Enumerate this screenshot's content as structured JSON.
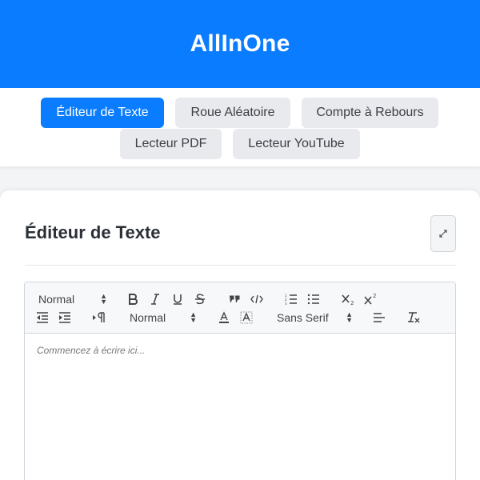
{
  "app": {
    "title": "AllInOne"
  },
  "tabs": [
    {
      "label": "Éditeur de Texte"
    },
    {
      "label": "Roue Aléatoire"
    },
    {
      "label": "Compte à Rebours"
    },
    {
      "label": "Lecteur PDF"
    },
    {
      "label": "Lecteur YouTube"
    }
  ],
  "active_tab": 0,
  "card": {
    "title": "Éditeur de Texte",
    "expand_icon": "expand-icon"
  },
  "editor": {
    "header_picker": "Normal",
    "size_picker": "Normal",
    "font_picker": "Sans Serif",
    "placeholder": "Commencez à écrire ici...",
    "toolbar_icons": [
      "bold-icon",
      "italic-icon",
      "underline-icon",
      "strike-icon",
      "blockquote-icon",
      "code-block-icon",
      "ordered-list-icon",
      "bullet-list-icon",
      "subscript-icon",
      "superscript-icon",
      "outdent-icon",
      "indent-icon",
      "rtl-direction-icon",
      "text-color-icon",
      "background-color-icon",
      "align-left-icon",
      "clear-format-icon"
    ]
  },
  "colors": {
    "primary": "#0a7cff",
    "tab_bg": "#e9eaee",
    "page_bg": "#f3f4f6"
  }
}
